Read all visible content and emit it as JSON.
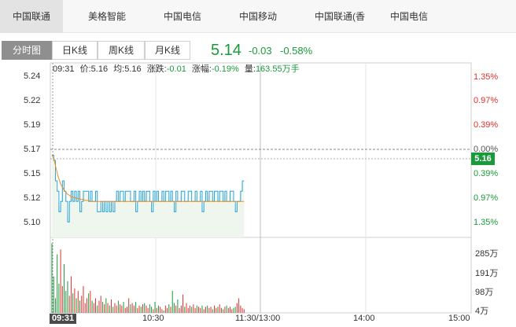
{
  "stock_tabs": [
    "中国联通",
    "美格智能",
    "中国电信",
    "中国移动",
    "中国联通(香",
    "中国电信"
  ],
  "period_tabs": [
    "分时图",
    "日K线",
    "周K线",
    "月K线"
  ],
  "quote": {
    "price": "5.14",
    "change": "-0.03",
    "change_pct": "-0.58%"
  },
  "info_bar": {
    "time": "09:31",
    "price_label": "价:",
    "price": "5.16",
    "avg_label": "均:",
    "avg": "5.16",
    "change_label": "涨跌:",
    "change": "-0.01",
    "amp_label": "涨幅:",
    "amp": "-0.19%",
    "vol_label": "量:",
    "vol": "163.55万手"
  },
  "price_axis": [
    "5.24",
    "5.22",
    "5.19",
    "5.17",
    "5.15",
    "5.12",
    "5.10"
  ],
  "pct_axis": [
    "1.35%",
    "0.97%",
    "0.39%",
    "0.00%",
    "0.39%",
    "0.97%",
    "1.35%"
  ],
  "current_price_tag": "5.16",
  "volume_axis": [
    "285万",
    "191万",
    "98万",
    "4万"
  ],
  "time_axis": [
    "09:31",
    "10:30",
    "11:30/13:00",
    "14:00",
    "15:00"
  ],
  "colors": {
    "up": "#e0302a",
    "down": "#1a9a3a",
    "price_line": "#2aa3d8",
    "avg_line": "#f08a1c",
    "prev_close": "#888888"
  },
  "chart_data": {
    "type": "line",
    "x_unit": "minute index from 09:30",
    "ylim": [
      5.085,
      5.255
    ],
    "prev_close": 5.17,
    "price_series": [
      5.165,
      5.16,
      5.14,
      5.13,
      5.11,
      5.12,
      5.14,
      5.13,
      5.12,
      5.1,
      5.12,
      5.13,
      5.12,
      5.13,
      5.12,
      5.13,
      5.11,
      5.12,
      5.13,
      5.13,
      5.13,
      5.12,
      5.13,
      5.12,
      5.12,
      5.13,
      5.11,
      5.11,
      5.12,
      5.11,
      5.12,
      5.11,
      5.12,
      5.11,
      5.12,
      5.11,
      5.12,
      5.13,
      5.12,
      5.13,
      5.13,
      5.12,
      5.13,
      5.13,
      5.13,
      5.12,
      5.12,
      5.13,
      5.11,
      5.12,
      5.13,
      5.12,
      5.13,
      5.12,
      5.13,
      5.13,
      5.12,
      5.11,
      5.13,
      5.12,
      5.13,
      5.12,
      5.12,
      5.13,
      5.12,
      5.13,
      5.13,
      5.12,
      5.13,
      5.12,
      5.11,
      5.13,
      5.12,
      5.12,
      5.13,
      5.13,
      5.12,
      5.12,
      5.13,
      5.13,
      5.12,
      5.12,
      5.13,
      5.12,
      5.12,
      5.13,
      5.11,
      5.12,
      5.13,
      5.12,
      5.13,
      5.13,
      5.12,
      5.13,
      5.13,
      5.12,
      5.13,
      5.13,
      5.12,
      5.13,
      5.12,
      5.12,
      5.13,
      5.13,
      5.12,
      5.11,
      5.12,
      5.12,
      5.13,
      5.14,
      5.14
    ],
    "avg_series": [
      5.165,
      5.162,
      5.155,
      5.148,
      5.142,
      5.137,
      5.134,
      5.131,
      5.129,
      5.127,
      5.126,
      5.125,
      5.124,
      5.124,
      5.123,
      5.123,
      5.122,
      5.122,
      5.122,
      5.121,
      5.121,
      5.121,
      5.12,
      5.12,
      5.12,
      5.12,
      5.12,
      5.12,
      5.12,
      5.12,
      5.12,
      5.12,
      5.12,
      5.12,
      5.12,
      5.12,
      5.12,
      5.12,
      5.12,
      5.12,
      5.12,
      5.12,
      5.12,
      5.12,
      5.12,
      5.12,
      5.12,
      5.12,
      5.12,
      5.12,
      5.12,
      5.12,
      5.12,
      5.12,
      5.12,
      5.12,
      5.12,
      5.12,
      5.12,
      5.12,
      5.12,
      5.12,
      5.12,
      5.12,
      5.12,
      5.12,
      5.12,
      5.12,
      5.12,
      5.12,
      5.12,
      5.12,
      5.12,
      5.12,
      5.12,
      5.12,
      5.12,
      5.12,
      5.12,
      5.12,
      5.12,
      5.12,
      5.12,
      5.12,
      5.12,
      5.12,
      5.12,
      5.12,
      5.12,
      5.12,
      5.12,
      5.12,
      5.12,
      5.12,
      5.12,
      5.12,
      5.12,
      5.12,
      5.12,
      5.12,
      5.12,
      5.12,
      5.12,
      5.12,
      5.12,
      5.12,
      5.12,
      5.12,
      5.12,
      5.12,
      5.12
    ],
    "volume_series_wan": [
      285,
      150,
      60,
      240,
      120,
      260,
      110,
      200,
      90,
      130,
      70,
      150,
      80,
      100,
      60,
      90,
      50,
      70,
      110,
      40,
      60,
      80,
      90,
      50,
      40,
      60,
      30,
      50,
      70,
      45,
      35,
      60,
      40,
      30,
      55,
      25,
      40,
      30,
      50,
      35,
      30,
      45,
      20,
      25,
      60,
      35,
      40,
      30,
      45,
      20,
      30,
      25,
      35,
      40,
      30,
      20,
      35,
      25,
      15,
      45,
      20,
      30,
      25,
      15,
      10,
      30,
      20,
      35,
      25,
      90,
      40,
      30,
      55,
      20,
      30,
      75,
      25,
      40,
      20,
      30,
      25,
      35,
      20,
      30,
      25,
      20,
      30,
      15,
      25,
      30,
      20,
      25,
      15,
      30,
      20,
      25,
      35,
      20,
      15,
      25,
      30,
      20,
      25,
      15,
      20,
      25,
      40,
      60,
      30,
      20,
      15
    ]
  }
}
